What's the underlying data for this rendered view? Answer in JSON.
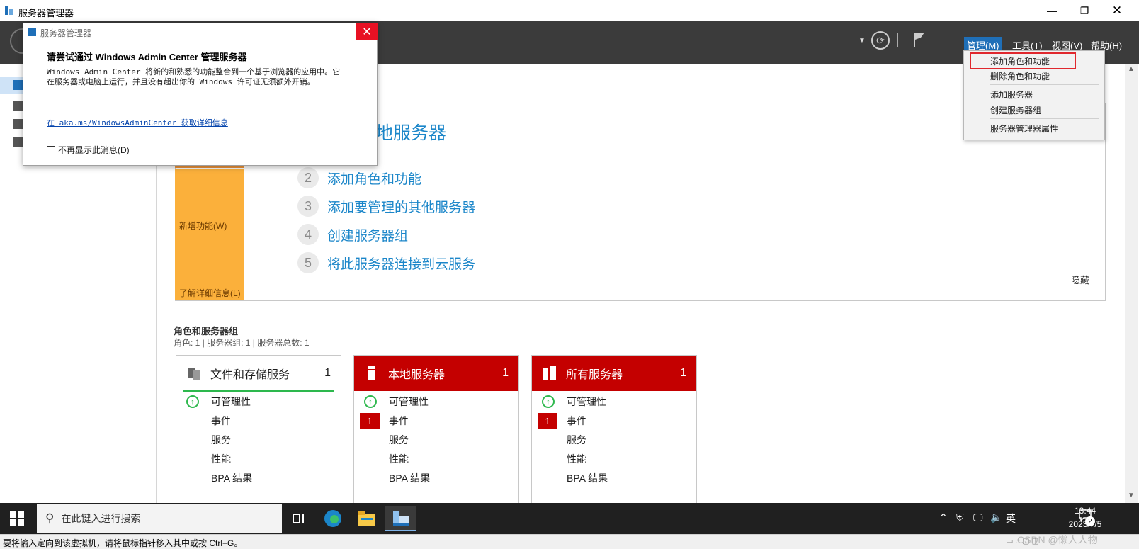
{
  "window": {
    "title": "服务器管理器"
  },
  "header": {
    "menus": [
      "管理(M)",
      "工具(T)",
      "视图(V)",
      "帮助(H)"
    ]
  },
  "quickstart": {
    "heading": "地服务器",
    "side_labels": {
      "new_features": "新增功能(W)",
      "learn_more": "了解详细信息(L)"
    },
    "steps": [
      {
        "num": "2",
        "text": "添加角色和功能"
      },
      {
        "num": "3",
        "text": "添加要管理的其他服务器"
      },
      {
        "num": "4",
        "text": "创建服务器组"
      },
      {
        "num": "5",
        "text": "将此服务器连接到云服务"
      }
    ],
    "hide_label": "隐藏"
  },
  "roles": {
    "title": "角色和服务器组",
    "summary": "角色: 1 | 服务器组: 1 | 服务器总数: 1",
    "tiles": [
      {
        "name": "文件和存储服务",
        "count": "1",
        "header_style": "white",
        "rows": [
          {
            "label": "可管理性",
            "status": "ok"
          },
          {
            "label": "事件",
            "status": ""
          },
          {
            "label": "服务",
            "status": ""
          },
          {
            "label": "性能",
            "status": ""
          },
          {
            "label": "BPA 结果",
            "status": ""
          }
        ]
      },
      {
        "name": "本地服务器",
        "count": "1",
        "header_style": "red",
        "rows": [
          {
            "label": "可管理性",
            "status": "ok"
          },
          {
            "label": "事件",
            "status": "1"
          },
          {
            "label": "服务",
            "status": ""
          },
          {
            "label": "性能",
            "status": ""
          },
          {
            "label": "BPA 结果",
            "status": ""
          }
        ]
      },
      {
        "name": "所有服务器",
        "count": "1",
        "header_style": "red",
        "rows": [
          {
            "label": "可管理性",
            "status": "ok"
          },
          {
            "label": "事件",
            "status": "1"
          },
          {
            "label": "服务",
            "status": ""
          },
          {
            "label": "性能",
            "status": ""
          },
          {
            "label": "BPA 结果",
            "status": ""
          }
        ]
      }
    ]
  },
  "popup": {
    "title": "服务器管理器",
    "heading": "请尝试通过 Windows Admin Center 管理服务器",
    "body_line1": "Windows Admin Center 将新的和熟悉的功能整合到一个基于浏览器的应用中。它",
    "body_line2": "在服务器或电脑上运行，并且没有超出你的 Windows 许可证无须额外开销。",
    "link": "在 aka.ms/WindowsAdminCenter 获取详细信息",
    "checkbox_label": "不再显示此消息(D)"
  },
  "manage_menu": {
    "items": [
      "添加角色和功能",
      "删除角色和功能",
      "添加服务器",
      "创建服务器组",
      "服务器管理器属性"
    ]
  },
  "taskbar": {
    "search_placeholder": "在此键入进行搜索",
    "ime": "英",
    "time": "13:44",
    "date": "2023/7/5",
    "notification_count": "2"
  },
  "statusbar": {
    "text": "要将输入定向到该虚拟机，请将鼠标指针移入其中或按 Ctrl+G。",
    "watermark": "CSDN @懒人人物"
  },
  "colors": {
    "accent_blue": "#1b86c9",
    "tile_red": "#c40000",
    "ok_green": "#2db84d",
    "quickstart_orange": "#fbb03b",
    "highlight_red": "#e0282e"
  }
}
